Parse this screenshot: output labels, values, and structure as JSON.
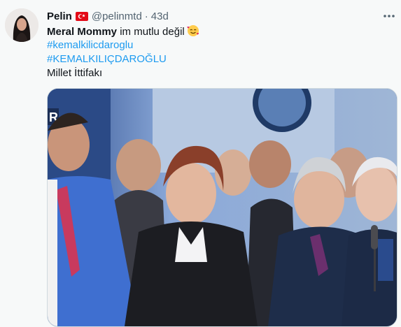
{
  "tweet": {
    "display_name": "Pelin",
    "flag_icon": "turkey-flag-icon",
    "handle": "@pelinmtd",
    "separator": "·",
    "age": "43d",
    "more_icon": "more-options-icon",
    "lines": {
      "l1_bold": "Meral Mommy",
      "l1_rest": " im mutlu değil",
      "l1_emoji": "smiling-face-with-hearts-icon",
      "l2_hashtag": "#kemalkilicdaroglu",
      "l3_hashtag": "#KEMALKILIÇDAROĞLU",
      "l4_text": "Millet İttifakı"
    },
    "media_logo_text": "R"
  },
  "colors": {
    "text": "#0f1419",
    "secondary": "#536471",
    "link": "#1d9bf0",
    "background": "#f7f9f9"
  }
}
